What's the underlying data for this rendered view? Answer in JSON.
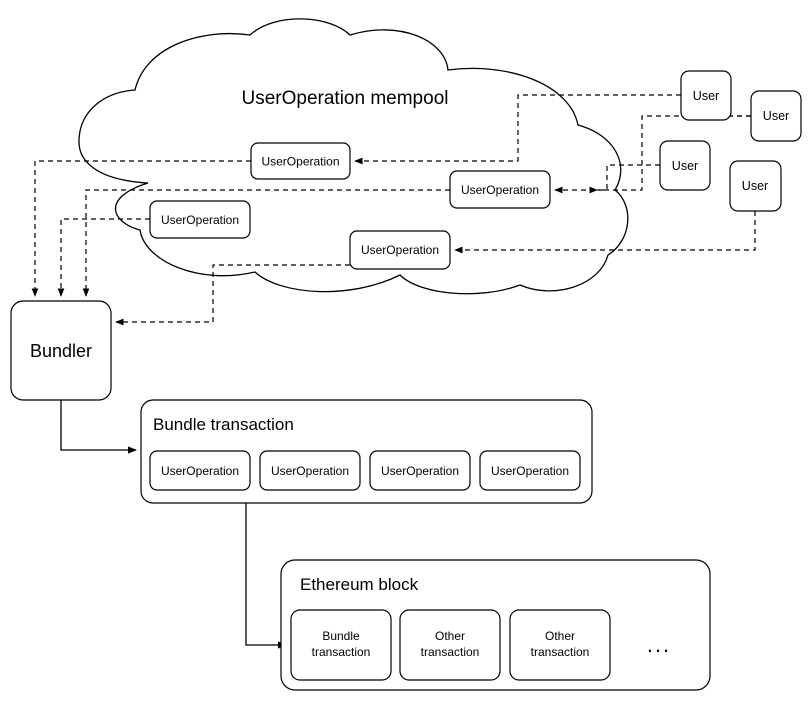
{
  "diagram": {
    "title": "UserOperation mempool",
    "cloud_label": "UserOperation mempool",
    "mempool_operations": [
      {
        "label": "UserOperation"
      },
      {
        "label": "UserOperation"
      },
      {
        "label": "UserOperation"
      },
      {
        "label": "UserOperation"
      }
    ],
    "users": [
      {
        "label": "User"
      },
      {
        "label": "User"
      },
      {
        "label": "User"
      },
      {
        "label": "User"
      }
    ],
    "bundler": {
      "label": "Bundler"
    },
    "bundle_transaction": {
      "title": "Bundle transaction",
      "operations": [
        {
          "label": "UserOperation"
        },
        {
          "label": "UserOperation"
        },
        {
          "label": "UserOperation"
        },
        {
          "label": "UserOperation"
        }
      ]
    },
    "ethereum_block": {
      "title": "Ethereum block",
      "transactions": [
        {
          "line1": "Bundle",
          "line2": "transaction"
        },
        {
          "line1": "Other",
          "line2": "transaction"
        },
        {
          "line1": "Other",
          "line2": "transaction"
        }
      ],
      "more_indicator": "..."
    },
    "colors": {
      "stroke": "#000000",
      "fill": "#ffffff",
      "text": "#000000"
    }
  }
}
